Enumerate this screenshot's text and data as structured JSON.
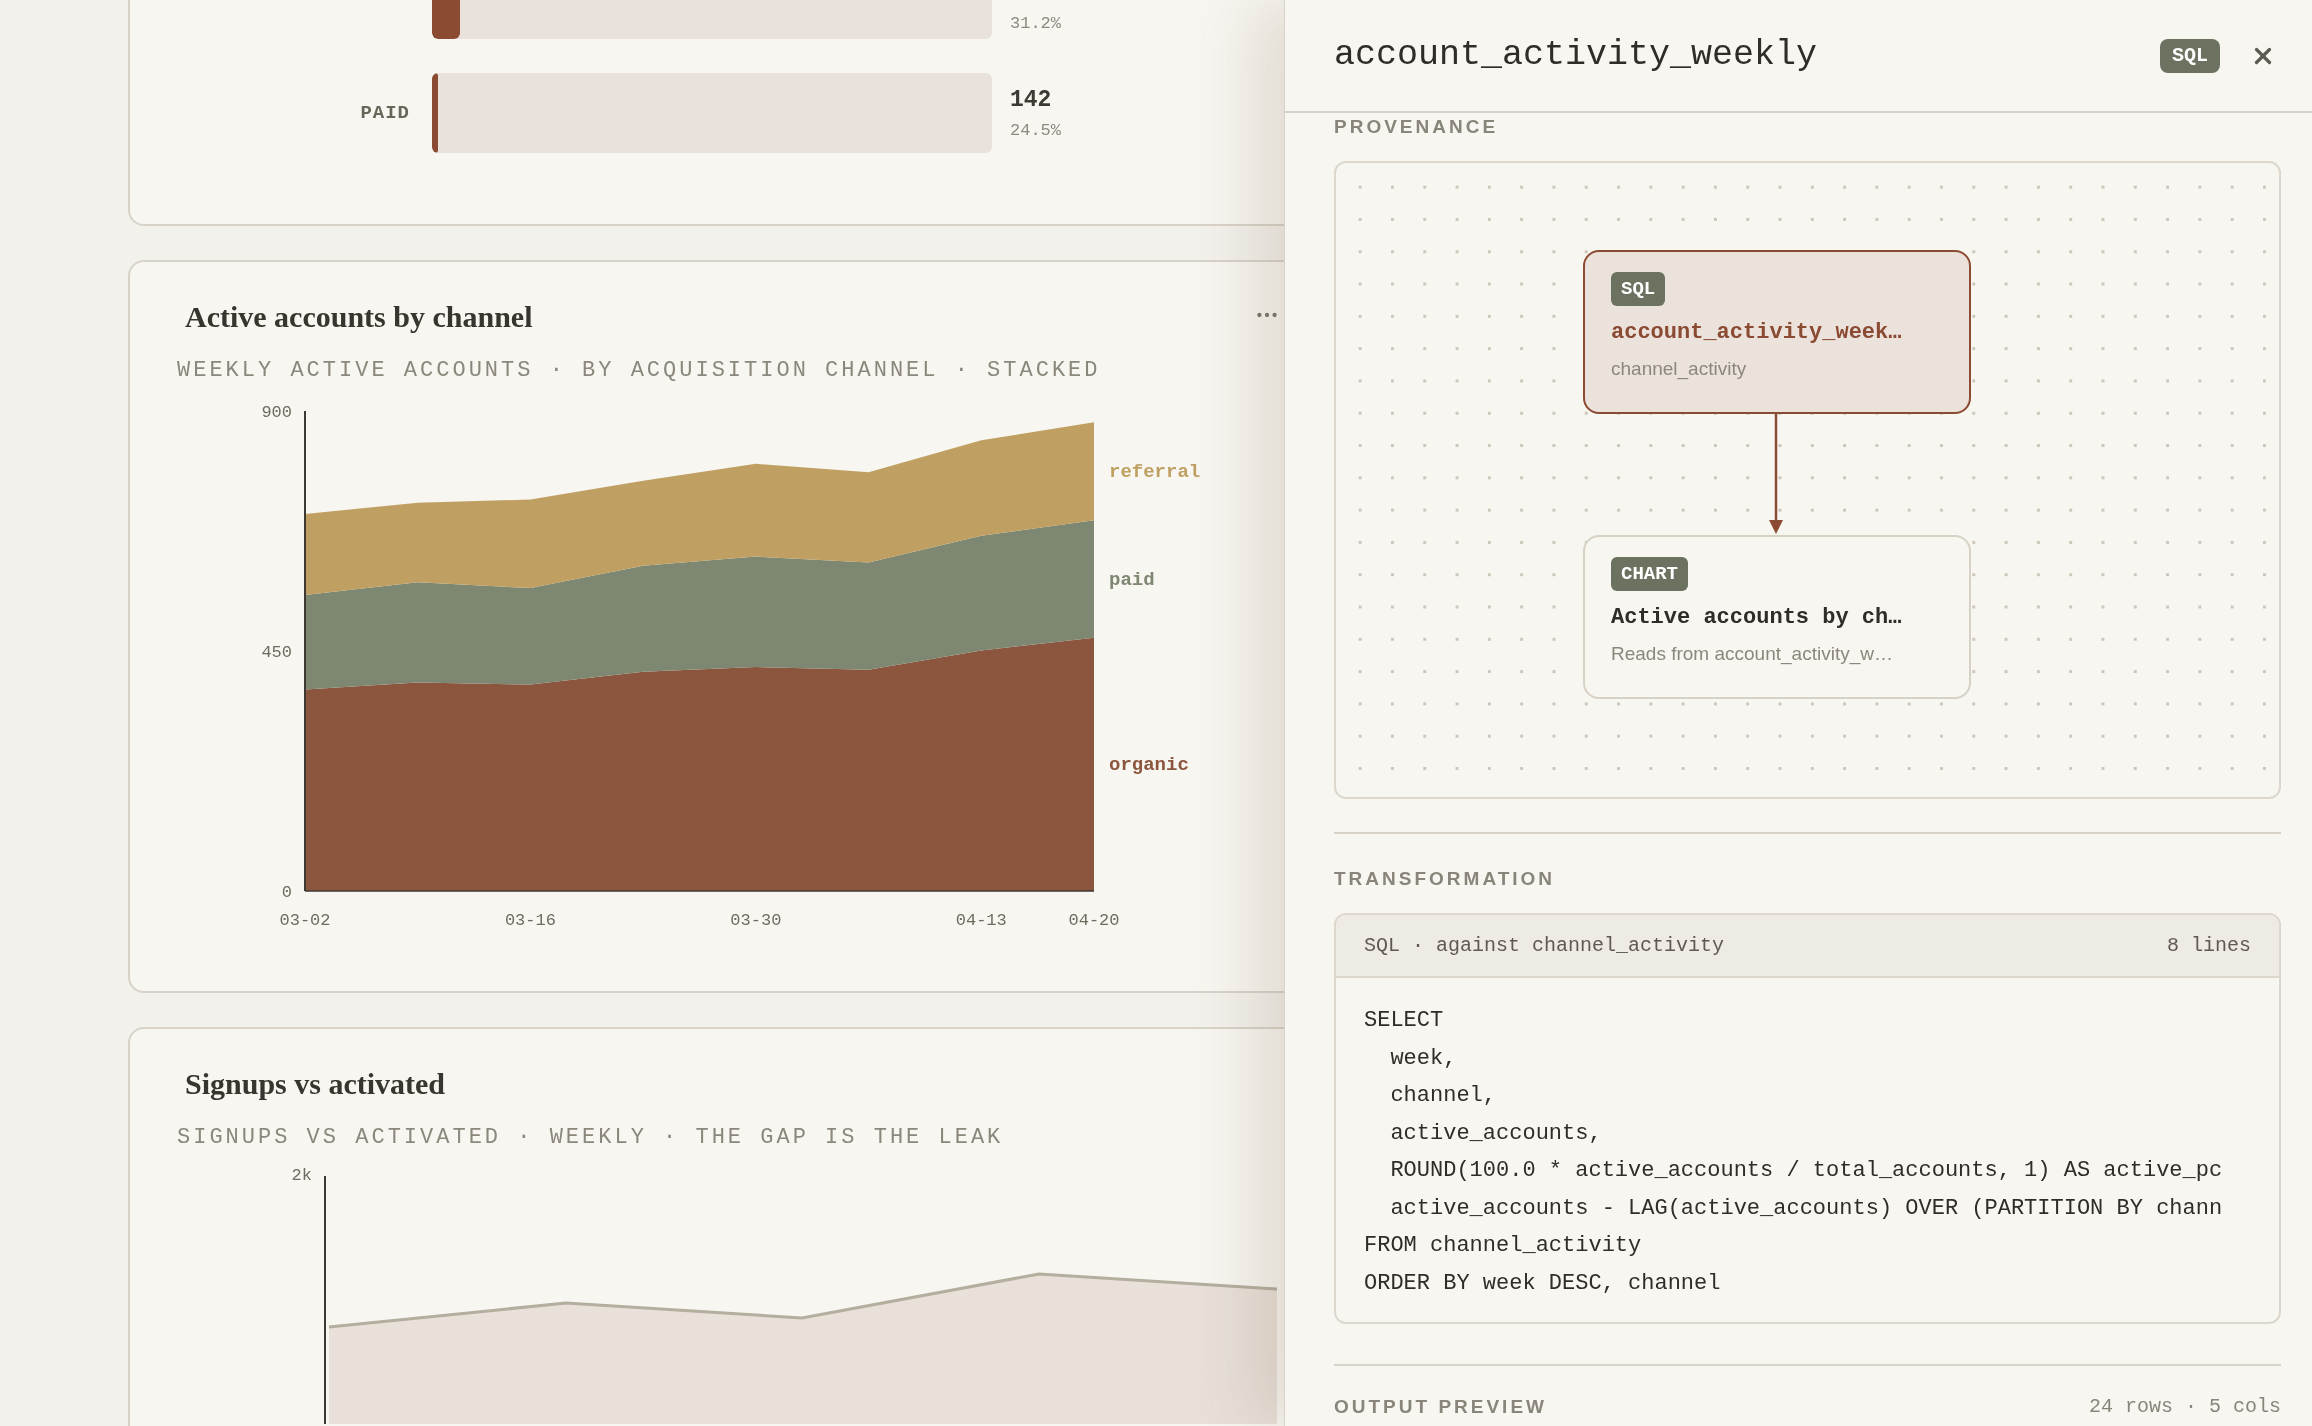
{
  "funnel_card": {
    "rows": [
      {
        "pct": "31.2%",
        "level": 0.05
      },
      {
        "label": "PAID",
        "count": "142",
        "pct": "24.5%",
        "level": 0.01
      }
    ]
  },
  "channel_card": {
    "title": "Active accounts by channel",
    "subtitle": "WEEKLY ACTIVE ACCOUNTS · BY ACQUISITION CHANNEL · STACKED",
    "chart_data": {
      "type": "area",
      "stacked": true,
      "categories": [
        "03-02",
        null,
        "03-16",
        null,
        "03-30",
        null,
        "04-13",
        "04-20"
      ],
      "ylim": [
        0,
        900
      ],
      "yticks": [
        0,
        450,
        900
      ],
      "series": [
        {
          "name": "organic",
          "color": "#8c553d",
          "values": [
            378,
            391,
            387,
            411,
            420,
            415,
            451,
            475
          ]
        },
        {
          "name": "paid",
          "color": "#7e8771",
          "values": [
            177,
            188,
            181,
            199,
            207,
            201,
            215,
            220
          ]
        },
        {
          "name": "referral",
          "color": "#bfa062",
          "values": [
            152,
            149,
            166,
            159,
            174,
            169,
            179,
            184
          ]
        }
      ]
    }
  },
  "signups_card": {
    "title": "Signups vs activated",
    "subtitle": "SIGNUPS VS ACTIVATED · WEEKLY · THE GAP IS THE LEAK",
    "y_tick": "2k"
  },
  "panel": {
    "title": "account_activity_weekly",
    "badge": "SQL",
    "provenance": {
      "heading": "PROVENANCE",
      "nodes": [
        {
          "kind": "source",
          "badge": "SQL",
          "title": "account_activity_week…",
          "subtitle": "channel_activity",
          "selected": true
        },
        {
          "kind": "chart",
          "badge": "CHART",
          "title": "Active accounts by ch…",
          "subtitle": "Reads from account_activity_w…",
          "selected": false
        }
      ]
    },
    "transformation": {
      "heading": "TRANSFORMATION",
      "code_header": "SQL · against channel_activity",
      "line_count": "8 lines",
      "lines": [
        "SELECT",
        "  week,",
        "  channel,",
        "  active_accounts,",
        "  ROUND(100.0 * active_accounts / total_accounts, 1) AS active_pc",
        "  active_accounts - LAG(active_accounts) OVER (PARTITION BY chann",
        "FROM channel_activity",
        "ORDER BY week DESC, channel"
      ]
    },
    "output_preview": {
      "heading": "OUTPUT PREVIEW",
      "summary": "24 rows · 5 cols"
    }
  }
}
